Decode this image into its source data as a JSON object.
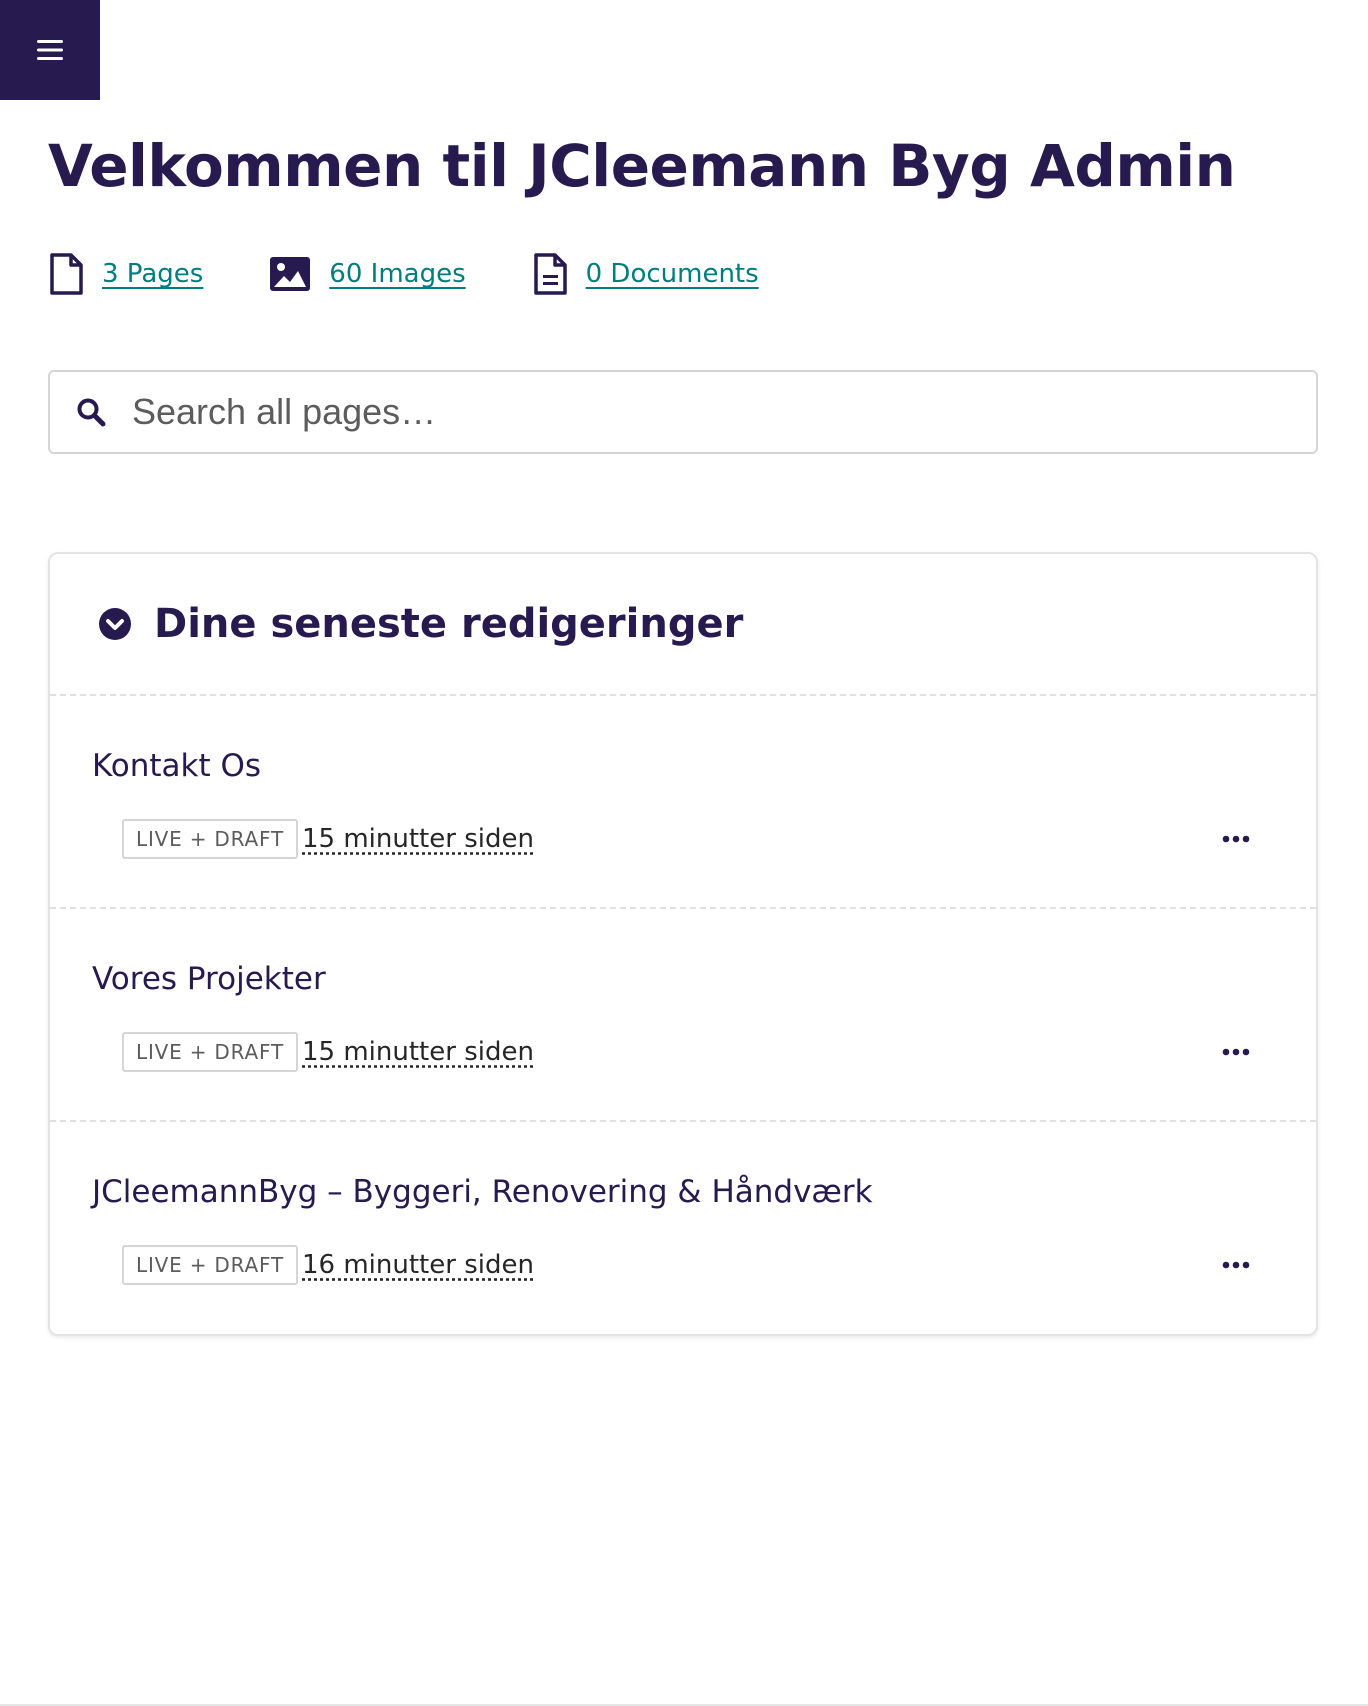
{
  "header": {
    "menu_icon": "hamburger-menu-icon",
    "title": "Velkommen til JCleemann Byg Admin"
  },
  "stats": [
    {
      "icon": "page-icon",
      "label": "3 Pages"
    },
    {
      "icon": "image-icon",
      "label": "60 Images"
    },
    {
      "icon": "document-icon",
      "label": "0 Documents"
    }
  ],
  "search": {
    "icon": "search-icon",
    "placeholder": "Search all pages…"
  },
  "recent_edits": {
    "icon": "chevron-down-circle-icon",
    "title": "Dine seneste redigeringer",
    "items": [
      {
        "title": "Kontakt Os",
        "status": "LIVE + DRAFT",
        "timestamp": "15 minutter siden"
      },
      {
        "title": "Vores Projekter",
        "status": "LIVE + DRAFT",
        "timestamp": "15 minutter siden"
      },
      {
        "title": "JCleemannByg – Byggeri, Renovering & Håndværk",
        "status": "LIVE + DRAFT",
        "timestamp": "16 minutter siden"
      }
    ]
  },
  "colors": {
    "primary": "#261a4f",
    "link": "#007d7e",
    "border": "#d5d5d5"
  }
}
